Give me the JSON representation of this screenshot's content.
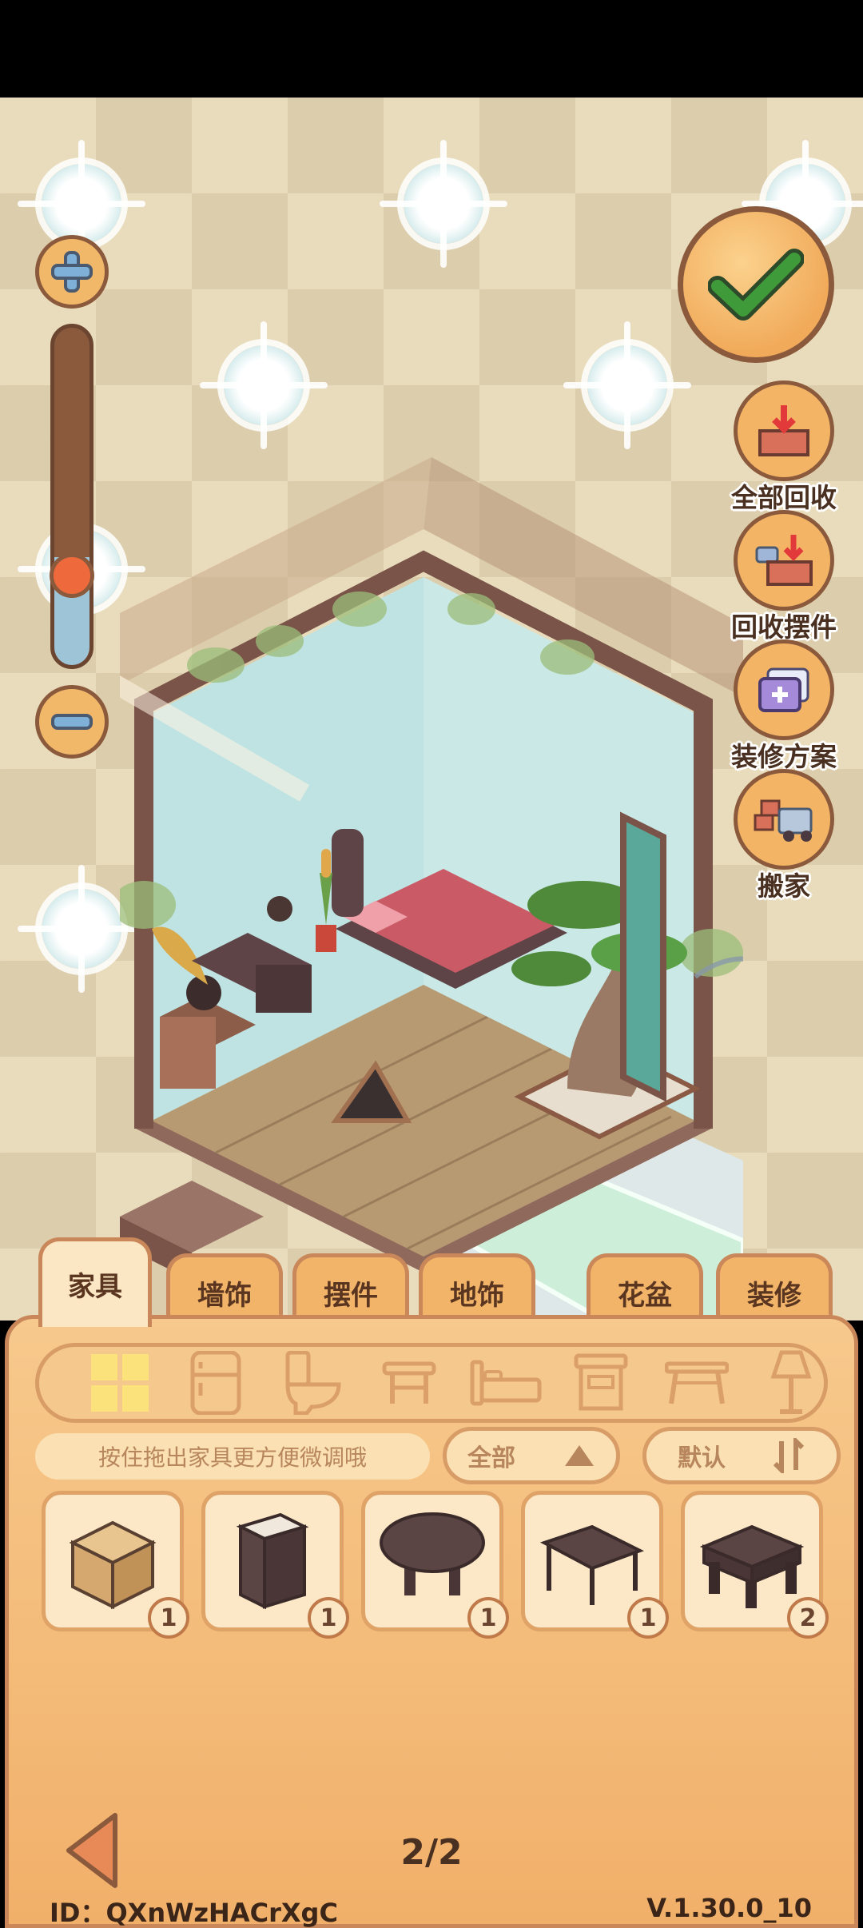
{
  "colors": {
    "panel": "#f1b06a",
    "accent_brown": "#8b5a3c",
    "confirm_green": "#3f9a3a",
    "scene_bg": "#e9dcbc"
  },
  "zoom": {
    "plus_icon": "plus-icon",
    "minus_icon": "minus-icon",
    "level": 0.32
  },
  "actions": [
    {
      "label": "全部回收",
      "icon": "recycle-all-icon"
    },
    {
      "label": "回收摆件",
      "icon": "recycle-ornament-icon"
    },
    {
      "label": "装修方案",
      "icon": "decor-plan-icon"
    },
    {
      "label": "搬家",
      "icon": "moving-truck-icon"
    }
  ],
  "tabs": [
    {
      "label": "家具",
      "active": true
    },
    {
      "label": "墙饰"
    },
    {
      "label": "摆件"
    },
    {
      "label": "地饰"
    },
    {
      "label": "花盆"
    },
    {
      "label": "装修"
    }
  ],
  "subcategories": [
    "all-grid-icon",
    "fridge-icon",
    "toilet-icon",
    "stool-icon",
    "bed-icon",
    "cabinet-icon",
    "table-icon",
    "lamp-icon"
  ],
  "hint": "按住拖出家具更方便微调哦",
  "filters": {
    "category": "全部",
    "sort": "默认"
  },
  "items": [
    {
      "name": "cardboard-box",
      "count": "1"
    },
    {
      "name": "dark-cabinet",
      "count": "1"
    },
    {
      "name": "round-table",
      "count": "1"
    },
    {
      "name": "long-table",
      "count": "1"
    },
    {
      "name": "square-stool",
      "count": "2"
    }
  ],
  "pagination": {
    "page": "2/2"
  },
  "footer": {
    "id": "ID：QXnWzHACrXgC",
    "version": "V.1.30.0_10"
  }
}
